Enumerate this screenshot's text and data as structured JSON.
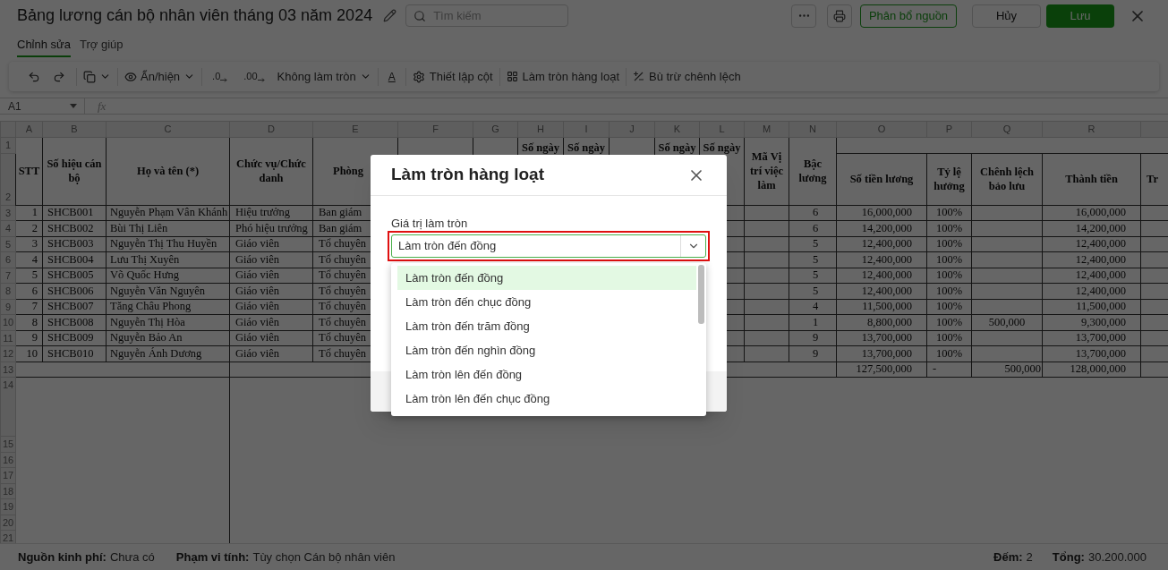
{
  "header": {
    "title": "Bảng lương cán bộ nhân viên tháng 03 năm 2024",
    "search": {
      "placeholder": "Tìm kiếm"
    },
    "buttons": [
      {
        "label": "Phân bổ nguồn",
        "kind": "outline"
      },
      {
        "label": "Hủy",
        "kind": "plain"
      },
      {
        "label": "Lưu",
        "kind": "primary"
      }
    ]
  },
  "tabs": [
    {
      "label": "Chỉnh sửa",
      "selected": true
    },
    {
      "label": "Trợ giúp",
      "selected": false
    }
  ],
  "toolbar": {
    "hide_show": "Ẩn/hiện",
    "decrease_decimal": ".0",
    "increase_decimal": ".00",
    "rounding": "Không làm tròn",
    "font_color": "A",
    "column_setup": "Thiết lập cột",
    "batch_round": "Làm tròn hàng loạt",
    "offset": "Bù trừ chênh lệch"
  },
  "formula_bar": {
    "cell": "A1",
    "fx": "fx"
  },
  "sheet": {
    "column_letters": [
      "A",
      "B",
      "C",
      "D",
      "E",
      "F",
      "G",
      "H",
      "I",
      "J",
      "K",
      "L",
      "M",
      "N",
      "O",
      "P",
      "Q",
      "R"
    ],
    "row_numbers": [
      "1",
      "2",
      "3",
      "4",
      "5",
      "6",
      "7",
      "8",
      "9",
      "10",
      "11",
      "12",
      "13",
      "14",
      "15",
      "16",
      "17",
      "18",
      "19",
      "20",
      "21"
    ],
    "headers": {
      "A": "STT",
      "B": "Số hiệu cán bộ",
      "C": "Họ và tên (*)",
      "D": "Chức vụ/Chức danh",
      "E": "Phòng",
      "H": "Số ngày",
      "I": "Số ngày",
      "K": "Số ngày",
      "L": "Số ngày",
      "M": "Mã Vị trí việc làm",
      "N": "Bậc lương",
      "O": "Số tiền lương",
      "P": "Tỷ lệ hưởng",
      "Q": "Chênh lệch bảo lưu",
      "R": "Thành tiền",
      "S": "Tr"
    },
    "rows": [
      {
        "stt": "1",
        "code": "SHCB001",
        "name": "Nguyễn Phạm Vân Khánh",
        "position": "Hiệu trưởng",
        "department": "Ban giám",
        "grade": "6",
        "salary": "16,000,000",
        "rate": "100%",
        "amount": "16,000,000"
      },
      {
        "stt": "2",
        "code": "SHCB002",
        "name": "Bùi Thị Liên",
        "position": "Phó hiệu trưởng",
        "department": "Ban giám",
        "grade": "6",
        "salary": "14,200,000",
        "rate": "100%",
        "amount": "14,200,000"
      },
      {
        "stt": "3",
        "code": "SHCB003",
        "name": "Nguyễn Thị Thu Huyền",
        "position": "Giáo viên",
        "department": "Tổ chuyên",
        "grade": "5",
        "salary": "12,400,000",
        "rate": "100%",
        "amount": "12,400,000"
      },
      {
        "stt": "4",
        "code": "SHCB004",
        "name": "Lưu Thị Xuyên",
        "position": "Giáo viên",
        "department": "Tổ chuyên",
        "grade": "5",
        "salary": "12,400,000",
        "rate": "100%",
        "amount": "12,400,000"
      },
      {
        "stt": "5",
        "code": "SHCB005",
        "name": "Võ Quốc Hưng",
        "position": "Giáo viên",
        "department": "Tổ chuyên",
        "grade": "5",
        "salary": "12,400,000",
        "rate": "100%",
        "amount": "12,400,000"
      },
      {
        "stt": "6",
        "code": "SHCB006",
        "name": "Nguyễn Văn Nguyên",
        "position": "Giáo viên",
        "department": "Tổ chuyên",
        "grade": "5",
        "salary": "12,400,000",
        "rate": "100%",
        "amount": "12,400,000"
      },
      {
        "stt": "7",
        "code": "SHCB007",
        "name": "Tăng Châu Phong",
        "position": "Giáo viên",
        "department": "Tổ chuyên",
        "grade": "4",
        "salary": "11,500,000",
        "rate": "100%",
        "amount": "11,500,000"
      },
      {
        "stt": "8",
        "code": "SHCB008",
        "name": "Nguyễn Thị Hòa",
        "position": "Giáo viên",
        "department": "Tổ chuyên",
        "grade": "1",
        "salary": "8,800,000",
        "rate": "100%",
        "difference": "500,000",
        "amount": "9,300,000"
      },
      {
        "stt": "9",
        "code": "SHCB009",
        "name": "Nguyễn Bảo An",
        "position": "Giáo viên",
        "department": "Tổ chuyên",
        "grade": "9",
        "salary": "13,700,000",
        "rate": "100%",
        "amount": "13,700,000"
      },
      {
        "stt": "10",
        "code": "SHCB010",
        "name": "Nguyễn Ánh Dương",
        "position": "Giáo viên",
        "department": "Tổ chuyên",
        "grade": "9",
        "salary": "13,700,000",
        "rate": "100%",
        "amount": "13,700,000"
      }
    ],
    "totals": {
      "salary": "127,500,000",
      "rate": "-",
      "difference": "500,000",
      "amount": "128,000,000"
    }
  },
  "status_bar": {
    "left": [
      {
        "label": "Nguồn kinh phí:",
        "value": "Chưa có"
      },
      {
        "label": "Phạm vi tính:",
        "value": "Tùy chọn Cán bộ nhân viên"
      }
    ],
    "right": [
      {
        "label": "Đếm:",
        "value": "2"
      },
      {
        "label": "Tổng:",
        "value": "30.200.000"
      }
    ]
  },
  "modal": {
    "title": "Làm tròn hàng loạt",
    "field_label": "Giá trị làm tròn",
    "value": "Làm tròn đến đồng",
    "options": [
      {
        "label": "Làm tròn đến đồng",
        "selected": true
      },
      {
        "label": "Làm tròn đến chục đồng",
        "selected": false
      },
      {
        "label": "Làm tròn đến trăm đồng",
        "selected": false
      },
      {
        "label": "Làm tròn đến nghìn đồng",
        "selected": false
      },
      {
        "label": "Làm tròn lên đến đồng",
        "selected": false
      },
      {
        "label": "Làm tròn lên đến chục đồng",
        "selected": false
      }
    ]
  }
}
